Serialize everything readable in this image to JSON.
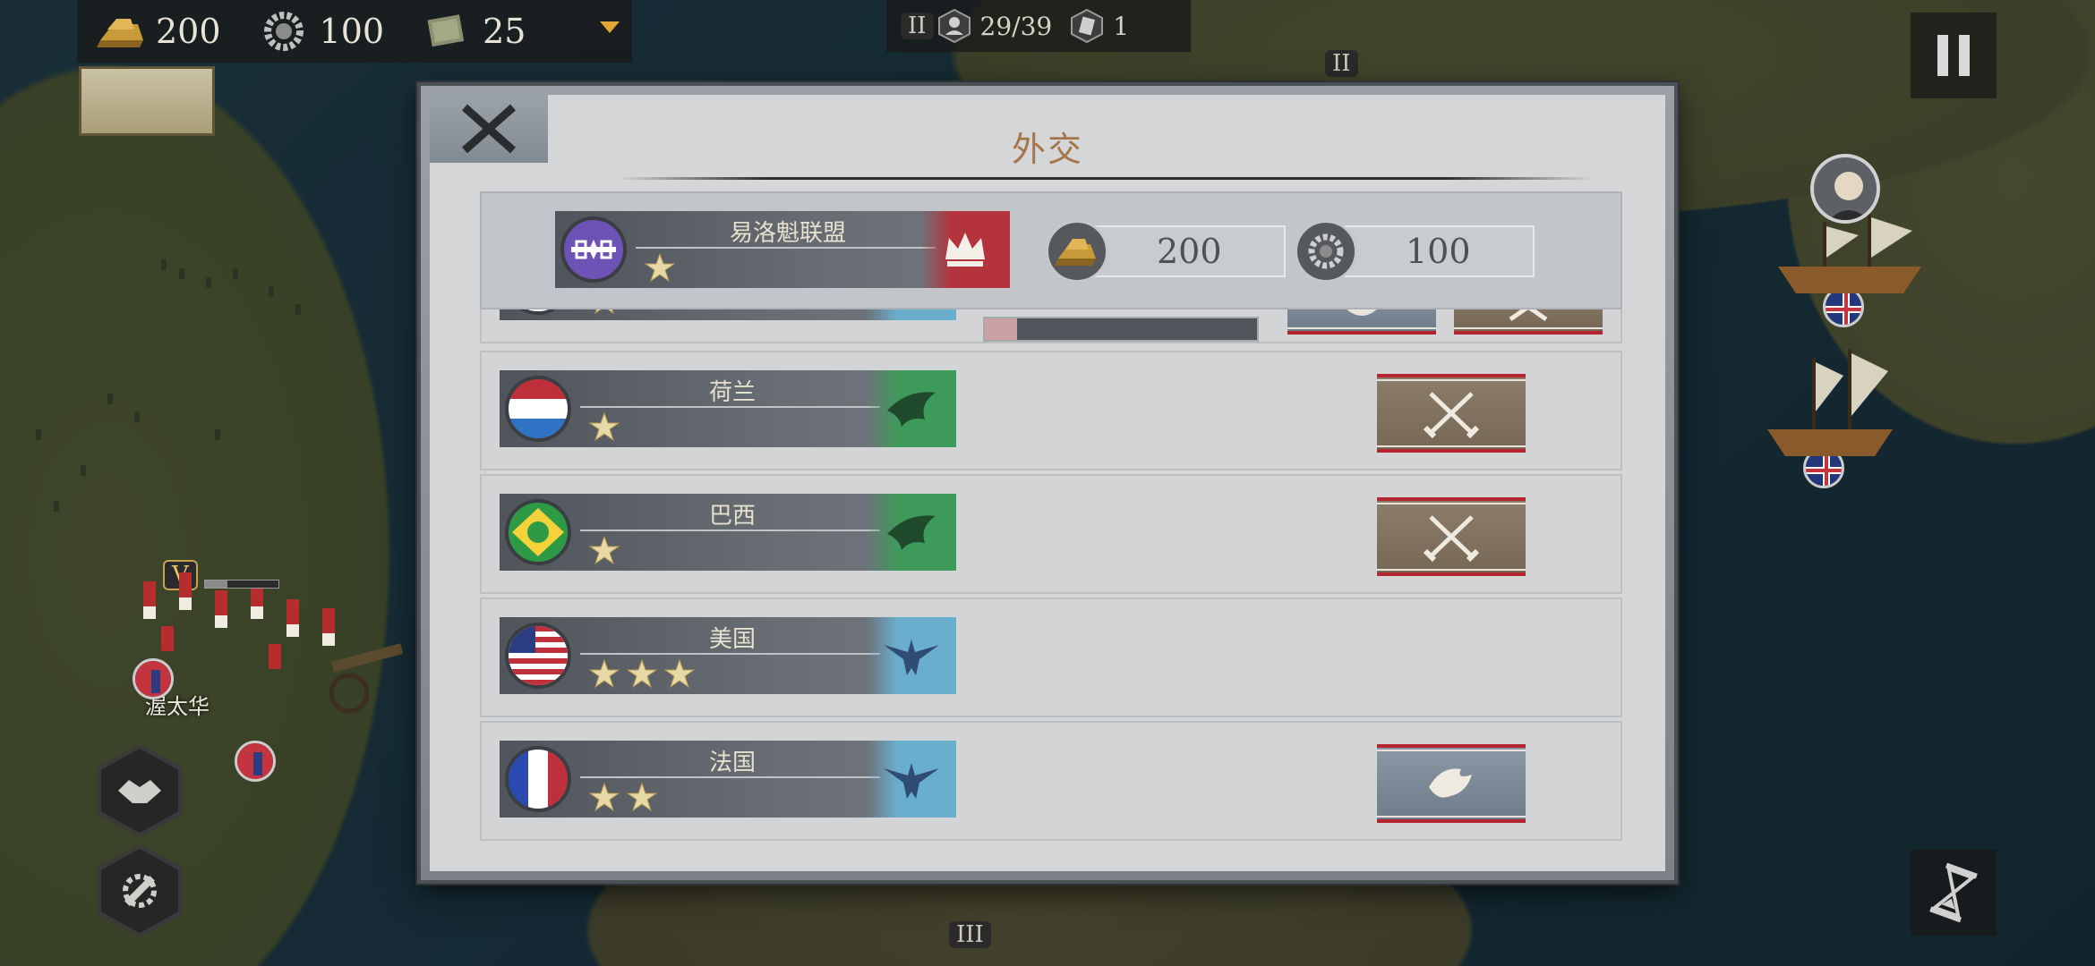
{
  "resources": {
    "gold": "200",
    "industry": "100",
    "command": "25"
  },
  "top_center": {
    "rank_badge": "II",
    "population": "29/39",
    "cards": "1"
  },
  "map": {
    "city_label": "渥太华",
    "unit_rank": "V",
    "army_badge_top": "II",
    "army_badge_bottom": "III"
  },
  "dialog": {
    "title": "外交",
    "player": {
      "name": "易洛魁联盟",
      "stars": 1,
      "gold": "200",
      "industry": "100"
    },
    "nations": [
      {
        "name": "",
        "stars": 1,
        "relation": "blue",
        "actions": [
          "peace",
          "war"
        ],
        "partial": true,
        "progress": 0.12
      },
      {
        "name": "荷兰",
        "stars": 1,
        "relation": "green",
        "actions": [
          "war"
        ]
      },
      {
        "name": "巴西",
        "stars": 1,
        "relation": "green",
        "actions": [
          "war"
        ]
      },
      {
        "name": "美国",
        "stars": 3,
        "relation": "blue",
        "actions": []
      },
      {
        "name": "法国",
        "stars": 2,
        "relation": "blue",
        "actions": [
          "peace"
        ]
      }
    ]
  },
  "colors": {
    "title_color": "#a5754a",
    "war_button": "#857563",
    "peace_button": "#7f8d9b",
    "button_stripe": "#b3262f"
  }
}
